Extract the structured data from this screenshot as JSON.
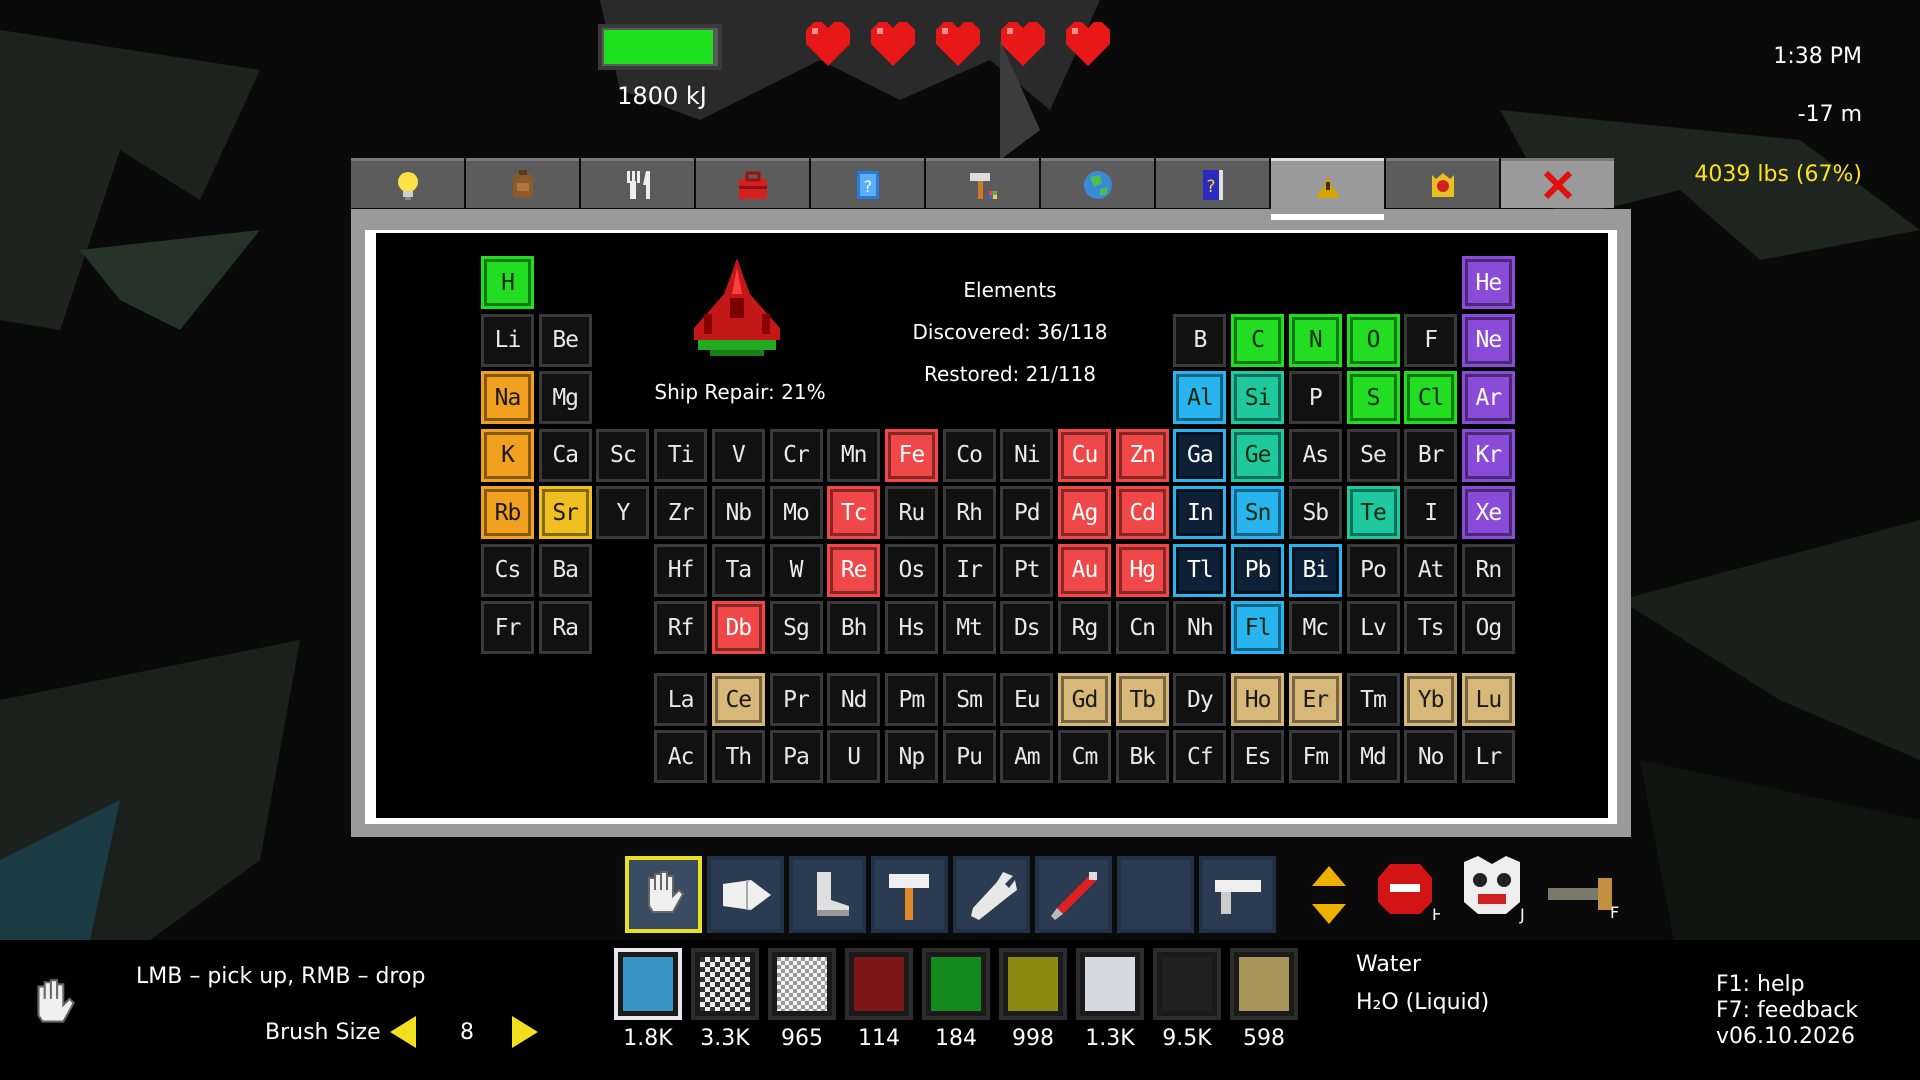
{
  "hud": {
    "energy_fraction": 0.97,
    "energy_label": "1800 kJ",
    "hearts": 5,
    "time": "1:38 PM",
    "depth": "-17 m",
    "weight": "4039 lbs (67%)",
    "weight_color": "#ffe21a"
  },
  "tabs": [
    {
      "icon": "lightbulb-icon"
    },
    {
      "icon": "backpack-icon"
    },
    {
      "icon": "fork-knife-icon"
    },
    {
      "icon": "toolbox-icon"
    },
    {
      "icon": "scroll-icon"
    },
    {
      "icon": "hammer-icon"
    },
    {
      "icon": "globe-icon"
    },
    {
      "icon": "book-icon"
    },
    {
      "icon": "ship-icon",
      "active": true
    },
    {
      "icon": "trophy-icon"
    },
    {
      "icon": "close-icon"
    }
  ],
  "elements_panel": {
    "title": "Elements",
    "discovered": "Discovered: 36/118",
    "restored": "Restored: 21/118",
    "ship_repair": "Ship Repair: 21%"
  },
  "element_colors": {
    "none": "#111111",
    "green": "#22dd22",
    "red": "#f04848",
    "orange": "#f2a020",
    "yellow": "#f0c020",
    "teal": "#20c8a0",
    "blue": "#28b4ee",
    "navy": "#16304e",
    "violet": "#8a4cd8",
    "beige": "#d8b878"
  },
  "elements": [
    {
      "s": "H",
      "r": 0,
      "c": 0,
      "k": "green"
    },
    {
      "s": "He",
      "r": 0,
      "c": 17,
      "k": "violet"
    },
    {
      "s": "Li",
      "r": 1,
      "c": 0,
      "k": "none"
    },
    {
      "s": "Be",
      "r": 1,
      "c": 1,
      "k": "none"
    },
    {
      "s": "B",
      "r": 1,
      "c": 12,
      "k": "none"
    },
    {
      "s": "C",
      "r": 1,
      "c": 13,
      "k": "green"
    },
    {
      "s": "N",
      "r": 1,
      "c": 14,
      "k": "green"
    },
    {
      "s": "O",
      "r": 1,
      "c": 15,
      "k": "green"
    },
    {
      "s": "F",
      "r": 1,
      "c": 16,
      "k": "none"
    },
    {
      "s": "Ne",
      "r": 1,
      "c": 17,
      "k": "violet"
    },
    {
      "s": "Na",
      "r": 2,
      "c": 0,
      "k": "orange"
    },
    {
      "s": "Mg",
      "r": 2,
      "c": 1,
      "k": "none"
    },
    {
      "s": "Al",
      "r": 2,
      "c": 12,
      "k": "blue"
    },
    {
      "s": "Si",
      "r": 2,
      "c": 13,
      "k": "teal"
    },
    {
      "s": "P",
      "r": 2,
      "c": 14,
      "k": "none"
    },
    {
      "s": "S",
      "r": 2,
      "c": 15,
      "k": "green"
    },
    {
      "s": "Cl",
      "r": 2,
      "c": 16,
      "k": "green"
    },
    {
      "s": "Ar",
      "r": 2,
      "c": 17,
      "k": "violet"
    },
    {
      "s": "K",
      "r": 3,
      "c": 0,
      "k": "orange"
    },
    {
      "s": "Ca",
      "r": 3,
      "c": 1,
      "k": "none"
    },
    {
      "s": "Sc",
      "r": 3,
      "c": 2,
      "k": "none"
    },
    {
      "s": "Ti",
      "r": 3,
      "c": 3,
      "k": "none"
    },
    {
      "s": "V",
      "r": 3,
      "c": 4,
      "k": "none"
    },
    {
      "s": "Cr",
      "r": 3,
      "c": 5,
      "k": "none"
    },
    {
      "s": "Mn",
      "r": 3,
      "c": 6,
      "k": "none"
    },
    {
      "s": "Fe",
      "r": 3,
      "c": 7,
      "k": "red"
    },
    {
      "s": "Co",
      "r": 3,
      "c": 8,
      "k": "none"
    },
    {
      "s": "Ni",
      "r": 3,
      "c": 9,
      "k": "none"
    },
    {
      "s": "Cu",
      "r": 3,
      "c": 10,
      "k": "red"
    },
    {
      "s": "Zn",
      "r": 3,
      "c": 11,
      "k": "red"
    },
    {
      "s": "Ga",
      "r": 3,
      "c": 12,
      "k": "navy"
    },
    {
      "s": "Ge",
      "r": 3,
      "c": 13,
      "k": "teal"
    },
    {
      "s": "As",
      "r": 3,
      "c": 14,
      "k": "none"
    },
    {
      "s": "Se",
      "r": 3,
      "c": 15,
      "k": "none"
    },
    {
      "s": "Br",
      "r": 3,
      "c": 16,
      "k": "none"
    },
    {
      "s": "Kr",
      "r": 3,
      "c": 17,
      "k": "violet"
    },
    {
      "s": "Rb",
      "r": 4,
      "c": 0,
      "k": "orange"
    },
    {
      "s": "Sr",
      "r": 4,
      "c": 1,
      "k": "yellow"
    },
    {
      "s": "Y",
      "r": 4,
      "c": 2,
      "k": "none"
    },
    {
      "s": "Zr",
      "r": 4,
      "c": 3,
      "k": "none"
    },
    {
      "s": "Nb",
      "r": 4,
      "c": 4,
      "k": "none"
    },
    {
      "s": "Mo",
      "r": 4,
      "c": 5,
      "k": "none"
    },
    {
      "s": "Tc",
      "r": 4,
      "c": 6,
      "k": "red"
    },
    {
      "s": "Ru",
      "r": 4,
      "c": 7,
      "k": "none"
    },
    {
      "s": "Rh",
      "r": 4,
      "c": 8,
      "k": "none"
    },
    {
      "s": "Pd",
      "r": 4,
      "c": 9,
      "k": "none"
    },
    {
      "s": "Ag",
      "r": 4,
      "c": 10,
      "k": "red"
    },
    {
      "s": "Cd",
      "r": 4,
      "c": 11,
      "k": "red"
    },
    {
      "s": "In",
      "r": 4,
      "c": 12,
      "k": "navy"
    },
    {
      "s": "Sn",
      "r": 4,
      "c": 13,
      "k": "blue"
    },
    {
      "s": "Sb",
      "r": 4,
      "c": 14,
      "k": "none"
    },
    {
      "s": "Te",
      "r": 4,
      "c": 15,
      "k": "teal"
    },
    {
      "s": "I",
      "r": 4,
      "c": 16,
      "k": "none"
    },
    {
      "s": "Xe",
      "r": 4,
      "c": 17,
      "k": "violet"
    },
    {
      "s": "Cs",
      "r": 5,
      "c": 0,
      "k": "none"
    },
    {
      "s": "Ba",
      "r": 5,
      "c": 1,
      "k": "none"
    },
    {
      "s": "Hf",
      "r": 5,
      "c": 3,
      "k": "none"
    },
    {
      "s": "Ta",
      "r": 5,
      "c": 4,
      "k": "none"
    },
    {
      "s": "W",
      "r": 5,
      "c": 5,
      "k": "none"
    },
    {
      "s": "Re",
      "r": 5,
      "c": 6,
      "k": "red"
    },
    {
      "s": "Os",
      "r": 5,
      "c": 7,
      "k": "none"
    },
    {
      "s": "Ir",
      "r": 5,
      "c": 8,
      "k": "none"
    },
    {
      "s": "Pt",
      "r": 5,
      "c": 9,
      "k": "none"
    },
    {
      "s": "Au",
      "r": 5,
      "c": 10,
      "k": "red"
    },
    {
      "s": "Hg",
      "r": 5,
      "c": 11,
      "k": "red"
    },
    {
      "s": "Tl",
      "r": 5,
      "c": 12,
      "k": "navy"
    },
    {
      "s": "Pb",
      "r": 5,
      "c": 13,
      "k": "navy"
    },
    {
      "s": "Bi",
      "r": 5,
      "c": 14,
      "k": "navy"
    },
    {
      "s": "Po",
      "r": 5,
      "c": 15,
      "k": "none"
    },
    {
      "s": "At",
      "r": 5,
      "c": 16,
      "k": "none"
    },
    {
      "s": "Rn",
      "r": 5,
      "c": 17,
      "k": "none"
    },
    {
      "s": "Fr",
      "r": 6,
      "c": 0,
      "k": "none"
    },
    {
      "s": "Ra",
      "r": 6,
      "c": 1,
      "k": "none"
    },
    {
      "s": "Rf",
      "r": 6,
      "c": 3,
      "k": "none"
    },
    {
      "s": "Db",
      "r": 6,
      "c": 4,
      "k": "red"
    },
    {
      "s": "Sg",
      "r": 6,
      "c": 5,
      "k": "none"
    },
    {
      "s": "Bh",
      "r": 6,
      "c": 6,
      "k": "none"
    },
    {
      "s": "Hs",
      "r": 6,
      "c": 7,
      "k": "none"
    },
    {
      "s": "Mt",
      "r": 6,
      "c": 8,
      "k": "none"
    },
    {
      "s": "Ds",
      "r": 6,
      "c": 9,
      "k": "none"
    },
    {
      "s": "Rg",
      "r": 6,
      "c": 10,
      "k": "none"
    },
    {
      "s": "Cn",
      "r": 6,
      "c": 11,
      "k": "none"
    },
    {
      "s": "Nh",
      "r": 6,
      "c": 12,
      "k": "none"
    },
    {
      "s": "Fl",
      "r": 6,
      "c": 13,
      "k": "blue"
    },
    {
      "s": "Mc",
      "r": 6,
      "c": 14,
      "k": "none"
    },
    {
      "s": "Lv",
      "r": 6,
      "c": 15,
      "k": "none"
    },
    {
      "s": "Ts",
      "r": 6,
      "c": 16,
      "k": "none"
    },
    {
      "s": "Og",
      "r": 6,
      "c": 17,
      "k": "none"
    },
    {
      "s": "La",
      "r": 7,
      "c": 3,
      "k": "none"
    },
    {
      "s": "Ce",
      "r": 7,
      "c": 4,
      "k": "beige"
    },
    {
      "s": "Pr",
      "r": 7,
      "c": 5,
      "k": "none"
    },
    {
      "s": "Nd",
      "r": 7,
      "c": 6,
      "k": "none"
    },
    {
      "s": "Pm",
      "r": 7,
      "c": 7,
      "k": "none"
    },
    {
      "s": "Sm",
      "r": 7,
      "c": 8,
      "k": "none"
    },
    {
      "s": "Eu",
      "r": 7,
      "c": 9,
      "k": "none"
    },
    {
      "s": "Gd",
      "r": 7,
      "c": 10,
      "k": "beige"
    },
    {
      "s": "Tb",
      "r": 7,
      "c": 11,
      "k": "beige"
    },
    {
      "s": "Dy",
      "r": 7,
      "c": 12,
      "k": "none"
    },
    {
      "s": "Ho",
      "r": 7,
      "c": 13,
      "k": "beige"
    },
    {
      "s": "Er",
      "r": 7,
      "c": 14,
      "k": "beige"
    },
    {
      "s": "Tm",
      "r": 7,
      "c": 15,
      "k": "none"
    },
    {
      "s": "Yb",
      "r": 7,
      "c": 16,
      "k": "beige"
    },
    {
      "s": "Lu",
      "r": 7,
      "c": 17,
      "k": "beige"
    },
    {
      "s": "Ac",
      "r": 8,
      "c": 3,
      "k": "none"
    },
    {
      "s": "Th",
      "r": 8,
      "c": 4,
      "k": "none"
    },
    {
      "s": "Pa",
      "r": 8,
      "c": 5,
      "k": "none"
    },
    {
      "s": "U",
      "r": 8,
      "c": 6,
      "k": "none"
    },
    {
      "s": "Np",
      "r": 8,
      "c": 7,
      "k": "none"
    },
    {
      "s": "Pu",
      "r": 8,
      "c": 8,
      "k": "none"
    },
    {
      "s": "Am",
      "r": 8,
      "c": 9,
      "k": "none"
    },
    {
      "s": "Cm",
      "r": 8,
      "c": 10,
      "k": "none"
    },
    {
      "s": "Bk",
      "r": 8,
      "c": 11,
      "k": "none"
    },
    {
      "s": "Cf",
      "r": 8,
      "c": 12,
      "k": "none"
    },
    {
      "s": "Es",
      "r": 8,
      "c": 13,
      "k": "none"
    },
    {
      "s": "Fm",
      "r": 8,
      "c": 14,
      "k": "none"
    },
    {
      "s": "Md",
      "r": 8,
      "c": 15,
      "k": "none"
    },
    {
      "s": "No",
      "r": 8,
      "c": 16,
      "k": "none"
    },
    {
      "s": "Lr",
      "r": 8,
      "c": 17,
      "k": "none"
    }
  ],
  "toolbar": {
    "tools": [
      {
        "icon": "hand-icon",
        "selected": true
      },
      {
        "icon": "drill-icon"
      },
      {
        "icon": "boot-icon"
      },
      {
        "icon": "hammer-icon"
      },
      {
        "icon": "wrench-icon"
      },
      {
        "icon": "torch-icon"
      },
      {
        "icon": "empty-slot"
      },
      {
        "icon": "gun-icon"
      }
    ],
    "extras": [
      {
        "icon": "up-down-arrows-icon"
      },
      {
        "icon": "red-creature-icon",
        "key": "H"
      },
      {
        "icon": "face-icon",
        "key": "J"
      },
      {
        "icon": "pipe-icon",
        "key": "F"
      }
    ]
  },
  "materials": [
    {
      "color": "#3a94c8",
      "count": "1.8K",
      "selected": true
    },
    {
      "color": "#888888",
      "count": "3.3K",
      "pattern": "checker-dark"
    },
    {
      "color": "#cccccc",
      "count": "965",
      "pattern": "checker-light"
    },
    {
      "color": "#7e1818",
      "count": "114"
    },
    {
      "color": "#148a1e",
      "count": "184"
    },
    {
      "color": "#8a8a10",
      "count": "998"
    },
    {
      "color": "#d4d8e0",
      "count": "1.3K"
    },
    {
      "color": "#202020",
      "count": "9.5K"
    },
    {
      "color": "#a8955a",
      "count": "598"
    }
  ],
  "selected_material": {
    "name": "Water",
    "formula": "H₂O (Liquid)"
  },
  "controls": {
    "hint": "LMB – pick up, RMB – drop",
    "brush_label": "Brush Size",
    "brush_value": "8"
  },
  "help": {
    "f1": "F1: help",
    "f7": "F7: feedback",
    "version": "v06.10.2026"
  }
}
